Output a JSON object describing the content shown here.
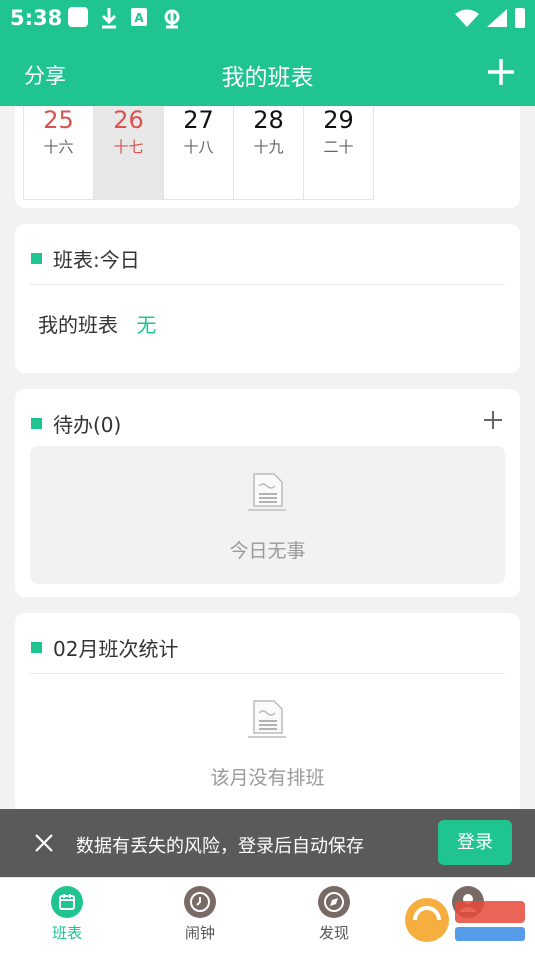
{
  "status_bar": {
    "time": "5:38",
    "icons": [
      "white-square-icon",
      "download-icon",
      "a-icon",
      "bug-icon"
    ],
    "right_icons": [
      "wifi-icon",
      "signal-icon",
      "battery-icon"
    ]
  },
  "app_bar": {
    "left_label": "分享",
    "title": "我的班表",
    "right_icon": "plus-icon"
  },
  "calendar": {
    "days": [
      {
        "num": "25",
        "lunar": "十六",
        "color": "red"
      },
      {
        "num": "26",
        "lunar": "十七",
        "color": "red",
        "today": true
      },
      {
        "num": "27",
        "lunar": "十八",
        "color": "dark"
      },
      {
        "num": "28",
        "lunar": "十九",
        "color": "dark"
      },
      {
        "num": "29",
        "lunar": "二十",
        "color": "dark"
      }
    ]
  },
  "today_card": {
    "title": "班表:今日",
    "row_label": "我的班表",
    "row_value": "无"
  },
  "todo_card": {
    "title": "待办(0)",
    "empty_text": "今日无事"
  },
  "stats_card": {
    "title": "02月班次统计",
    "empty_text": "该月没有排班"
  },
  "snackbar": {
    "message": "数据有丢失的风险，登录后自动保存",
    "button": "登录"
  },
  "tabs": [
    {
      "label": "班表",
      "icon": "calendar-icon",
      "active": true
    },
    {
      "label": "闹钟",
      "icon": "clock-icon",
      "active": false
    },
    {
      "label": "发现",
      "icon": "compass-icon",
      "active": false
    },
    {
      "label": "",
      "icon": "profile-icon",
      "active": false
    }
  ],
  "colors": {
    "accent": "#1fc490",
    "weekend_red": "#d9534f",
    "background": "#f2f2f2"
  }
}
